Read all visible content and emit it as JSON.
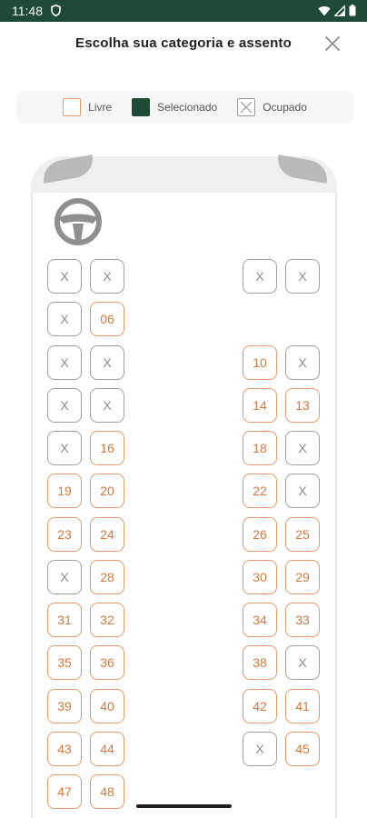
{
  "status_bar": {
    "time": "11:48"
  },
  "header": {
    "title": "Escolha sua categoria e assento"
  },
  "legend": {
    "free": "Livre",
    "selected": "Selecionado",
    "occupied": "Ocupado"
  },
  "colors": {
    "brand": "#1e4a36",
    "free_border": "#e39a6f",
    "free_text": "#d4783f",
    "occupied": "#a0a0a0"
  },
  "seat_rows": [
    {
      "left": [
        {
          "label": "X",
          "status": "occupied"
        },
        {
          "label": "X",
          "status": "occupied"
        }
      ],
      "right": [
        {
          "label": "X",
          "status": "occupied"
        },
        {
          "label": "X",
          "status": "occupied"
        }
      ]
    },
    {
      "left": [
        {
          "label": "X",
          "status": "occupied"
        },
        {
          "label": "06",
          "status": "free"
        }
      ],
      "right": []
    },
    {
      "left": [
        {
          "label": "X",
          "status": "occupied"
        },
        {
          "label": "X",
          "status": "occupied"
        }
      ],
      "right": [
        {
          "label": "10",
          "status": "free"
        },
        {
          "label": "X",
          "status": "occupied"
        }
      ]
    },
    {
      "left": [
        {
          "label": "X",
          "status": "occupied"
        },
        {
          "label": "X",
          "status": "occupied"
        }
      ],
      "right": [
        {
          "label": "14",
          "status": "free"
        },
        {
          "label": "13",
          "status": "free"
        }
      ]
    },
    {
      "left": [
        {
          "label": "X",
          "status": "occupied"
        },
        {
          "label": "16",
          "status": "free"
        }
      ],
      "right": [
        {
          "label": "18",
          "status": "free"
        },
        {
          "label": "X",
          "status": "occupied"
        }
      ]
    },
    {
      "left": [
        {
          "label": "19",
          "status": "free"
        },
        {
          "label": "20",
          "status": "free"
        }
      ],
      "right": [
        {
          "label": "22",
          "status": "free"
        },
        {
          "label": "X",
          "status": "occupied"
        }
      ]
    },
    {
      "left": [
        {
          "label": "23",
          "status": "free"
        },
        {
          "label": "24",
          "status": "free"
        }
      ],
      "right": [
        {
          "label": "26",
          "status": "free"
        },
        {
          "label": "25",
          "status": "free"
        }
      ]
    },
    {
      "left": [
        {
          "label": "X",
          "status": "occupied"
        },
        {
          "label": "28",
          "status": "free"
        }
      ],
      "right": [
        {
          "label": "30",
          "status": "free"
        },
        {
          "label": "29",
          "status": "free"
        }
      ]
    },
    {
      "left": [
        {
          "label": "31",
          "status": "free"
        },
        {
          "label": "32",
          "status": "free"
        }
      ],
      "right": [
        {
          "label": "34",
          "status": "free"
        },
        {
          "label": "33",
          "status": "free"
        }
      ]
    },
    {
      "left": [
        {
          "label": "35",
          "status": "free"
        },
        {
          "label": "36",
          "status": "free"
        }
      ],
      "right": [
        {
          "label": "38",
          "status": "free"
        },
        {
          "label": "X",
          "status": "occupied"
        }
      ]
    },
    {
      "left": [
        {
          "label": "39",
          "status": "free"
        },
        {
          "label": "40",
          "status": "free"
        }
      ],
      "right": [
        {
          "label": "42",
          "status": "free"
        },
        {
          "label": "41",
          "status": "free"
        }
      ]
    },
    {
      "left": [
        {
          "label": "43",
          "status": "free"
        },
        {
          "label": "44",
          "status": "free"
        }
      ],
      "right": [
        {
          "label": "X",
          "status": "occupied"
        },
        {
          "label": "45",
          "status": "free"
        }
      ]
    },
    {
      "left": [
        {
          "label": "47",
          "status": "free"
        },
        {
          "label": "48",
          "status": "free"
        }
      ],
      "right": []
    }
  ]
}
